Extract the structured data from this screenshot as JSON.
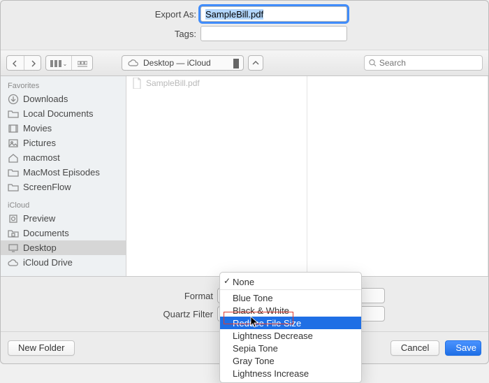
{
  "form": {
    "export_label": "Export As:",
    "export_value": "SampleBill.pdf",
    "tags_label": "Tags:",
    "tags_value": ""
  },
  "toolbar": {
    "path_location": "Desktop — iCloud",
    "search_placeholder": "Search"
  },
  "sidebar": {
    "section_favorites": "Favorites",
    "favorites": [
      {
        "label": "Downloads",
        "icon": "download-icon"
      },
      {
        "label": "Local Documents",
        "icon": "folder-icon"
      },
      {
        "label": "Movies",
        "icon": "movies-icon"
      },
      {
        "label": "Pictures",
        "icon": "pictures-icon"
      },
      {
        "label": "macmost",
        "icon": "home-icon"
      },
      {
        "label": "MacMost Episodes",
        "icon": "folder-icon"
      },
      {
        "label": "ScreenFlow",
        "icon": "folder-icon"
      }
    ],
    "section_icloud": "iCloud",
    "icloud": [
      {
        "label": "Preview",
        "icon": "preview-icon"
      },
      {
        "label": "Documents",
        "icon": "doc-folder-icon"
      },
      {
        "label": "Desktop",
        "icon": "desktop-icon",
        "selected": true
      },
      {
        "label": "iCloud Drive",
        "icon": "cloud-icon"
      }
    ]
  },
  "filelist": {
    "items": [
      {
        "name": "SampleBill.pdf"
      }
    ]
  },
  "options": {
    "format_label": "Format",
    "filter_label": "Quartz Filter"
  },
  "menu": {
    "none": "None",
    "items": [
      "Blue Tone",
      "Black & White",
      "Reduce File Size",
      "Lightness Decrease",
      "Sepia Tone",
      "Gray Tone",
      "Lightness Increase"
    ],
    "highlighted_index": 2
  },
  "footer": {
    "new_folder": "New Folder",
    "cancel": "Cancel",
    "save": "Save"
  }
}
